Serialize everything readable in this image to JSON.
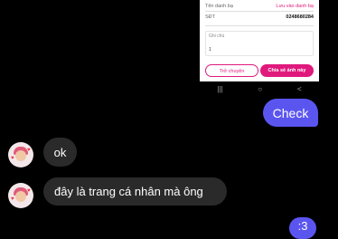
{
  "shared_card": {
    "account_name_label": "Tên danh bạ",
    "save_contact_label": "Lưu vào danh bạ",
    "phone_label": "SĐT",
    "phone_value": "0248680284",
    "note_label": "Ghi chú",
    "note_value": "1",
    "back_button": "Trở chuyện",
    "share_button": "Chia sẻ ảnh này"
  },
  "navbar": {
    "recent": "|||",
    "home": "○",
    "back": "<"
  },
  "messages": {
    "outgoing_check": "Check",
    "incoming_1": "ok",
    "incoming_2": "đây là trang cá nhân mà ông",
    "outgoing_2": ":3"
  }
}
